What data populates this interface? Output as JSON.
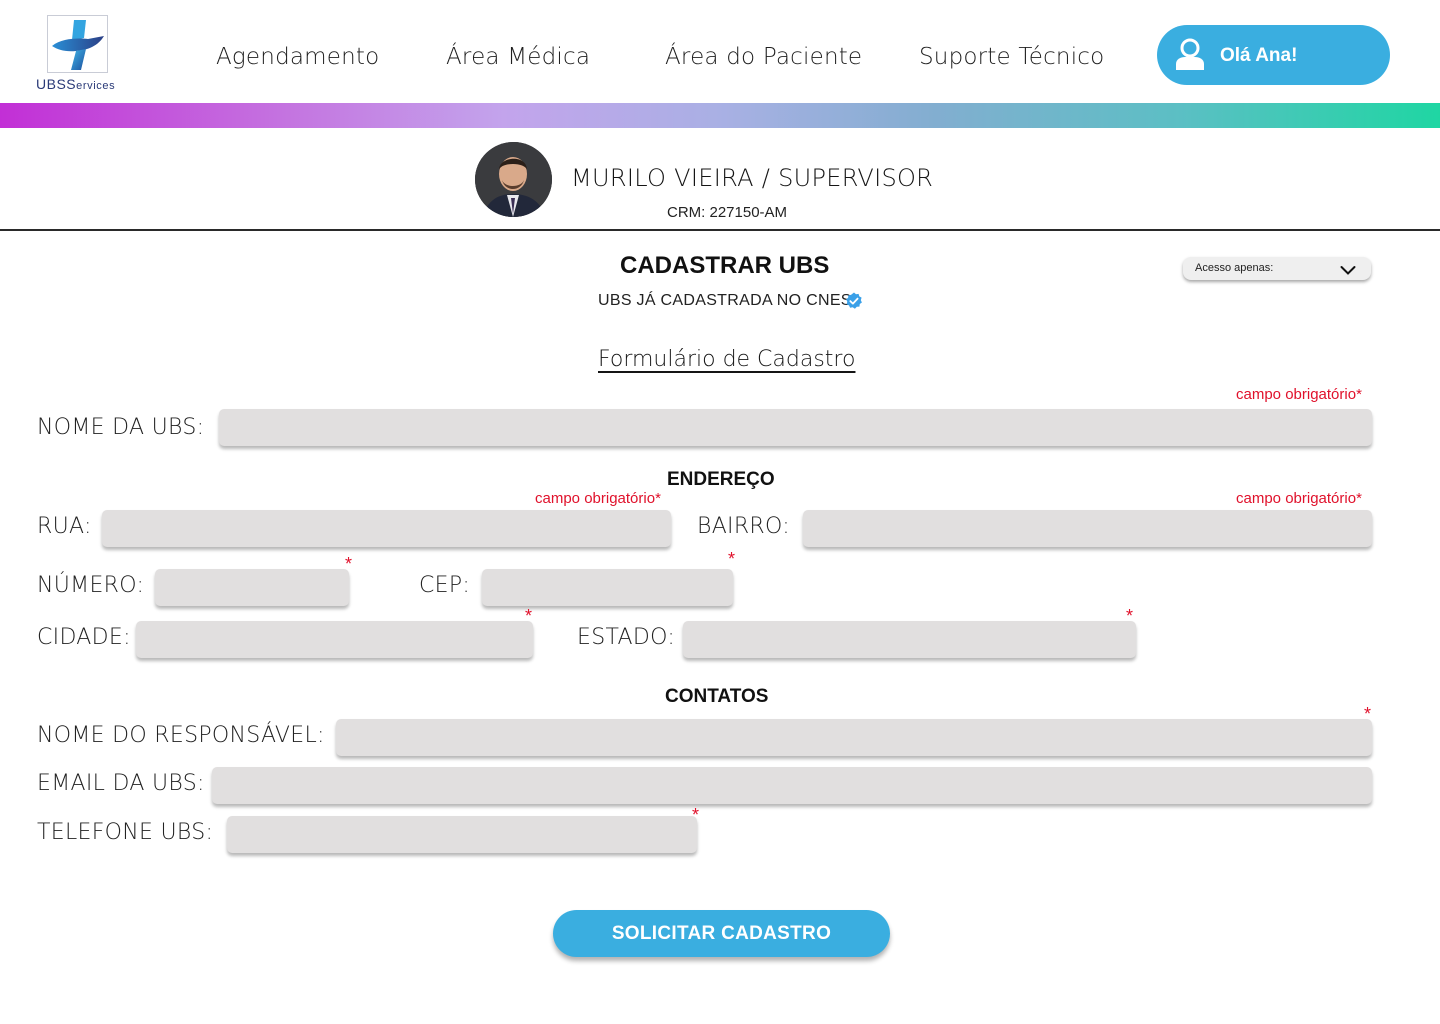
{
  "header": {
    "logo_text_main": "UBS",
    "logo_text_sub": "ervices",
    "logo_text_S": "S",
    "nav": [
      "Agendamento",
      "Área Médica",
      "Área do Paciente",
      "Suporte Técnico"
    ],
    "user_greeting": "Olá Ana!"
  },
  "profile": {
    "name": "MURILO VIEIRA / SUPERVISOR",
    "crm": "CRM: 227150-AM"
  },
  "page": {
    "title": "CADASTRAR UBS",
    "cnes_status": "UBS JÁ CADASTRADA NO CNES",
    "access_select": "Acesso apenas:",
    "form_title": "Formulário de Cadastro"
  },
  "form": {
    "required_note": "campo obrigatório*",
    "required_star": "*",
    "nome_ubs_label": "NOME DA UBS:",
    "endereco_section": "ENDEREÇO",
    "rua_label": "RUA:",
    "bairro_label": "BAIRRO:",
    "numero_label": "NÚMERO:",
    "cep_label": "CEP:",
    "cidade_label": "CIDADE:",
    "estado_label": "ESTADO:",
    "contatos_section": "CONTATOS",
    "responsavel_label": "NOME DO RESPONSÁVEL:",
    "email_label": "EMAIL DA UBS:",
    "telefone_label": "TELEFONE UBS:",
    "submit": "SOLICITAR CADASTRO"
  },
  "colors": {
    "accent": "#3aaee0",
    "required": "#e0112b",
    "field_bg": "#e1dfdf",
    "logo_blue": "#2a3a78"
  }
}
